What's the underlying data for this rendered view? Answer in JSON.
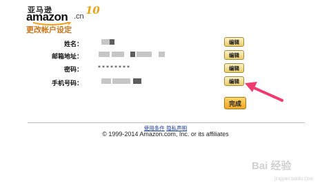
{
  "logo": {
    "cn_title": "亚马逊",
    "brand": "amazon",
    "brand_suffix": ".cn",
    "anniversary": "10"
  },
  "page_title": "更改帐户设定",
  "rows": [
    {
      "label": "姓名："
    },
    {
      "label": "邮箱地址："
    },
    {
      "label": "密码：",
      "value": "********"
    },
    {
      "label": "手机号码："
    }
  ],
  "edit_label": "编辑",
  "done_label": "完成",
  "footer": {
    "links": [
      "使用条件",
      "隐私声明"
    ],
    "copyright": "© 1999-2014 Amazon.com, Inc. or its affiliates"
  },
  "watermark": {
    "text": "Bai 经验",
    "sub": "jingyan.baidu.com"
  },
  "colors": {
    "title": "#c8761b",
    "link": "#1a3e9e",
    "arrow": "#f03a6e",
    "button": "#eccd6a",
    "done_button": "#f0a623"
  }
}
